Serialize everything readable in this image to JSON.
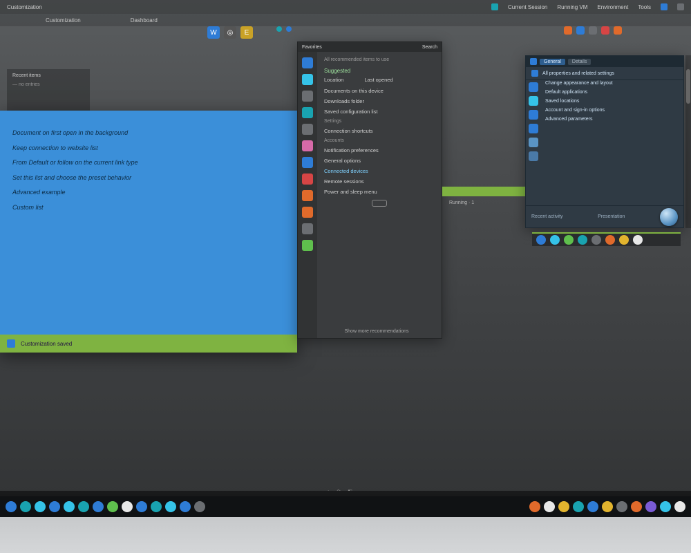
{
  "menubar": {
    "left": "Customization",
    "items": [
      "Current Session",
      "Running VM",
      "Environment",
      "Tools"
    ],
    "right_icons": [
      "globe-icon",
      "note-icon"
    ]
  },
  "tabs": {
    "a": "Customization",
    "b": "Dashboard"
  },
  "toolstrip_labels": [
    "W",
    "◎",
    "E"
  ],
  "panel_left": {
    "line1": "Recent items",
    "line2": "— no entries"
  },
  "doc": {
    "lines": [
      "Document on first open in the background",
      "Keep connection to website list",
      "From Default or follow on the current link type",
      "Set this list and choose the preset behavior",
      "Advanced example",
      "Custom list"
    ],
    "status": "Customization saved"
  },
  "start": {
    "title_left": "Favorites",
    "title_right": "Search",
    "subtitle": "All recommended items to use",
    "section_a": "Suggested",
    "header_l": "Location",
    "header_r": "Last opened",
    "items": [
      "Documents on this device",
      "Downloads folder",
      "Saved configuration list",
      "Settings",
      "Connection shortcuts",
      "Accounts",
      "Notification preferences",
      "General options",
      "Connected devices",
      "Remote sessions",
      "Power and sleep menu"
    ],
    "footer": "Show more recommendations"
  },
  "greenlabel": "Running · 1",
  "prop": {
    "tab_a": "General",
    "tab_b": "Details",
    "header": "All properties and related settings",
    "rows": [
      "Change appearance and layout",
      "Default applications",
      "Saved locations",
      "Account and sign-in options",
      "Advanced parameters"
    ],
    "foot_l": "Recent activity",
    "foot_r": "Presentation"
  },
  "minibar_colors": [
    "c-blue",
    "c-cyan",
    "c-green",
    "c-teal",
    "c-grey",
    "c-orn",
    "c-yel",
    "c-white"
  ],
  "taskbar_left": [
    "c-blue",
    "c-teal",
    "c-cyan",
    "c-blue",
    "c-cyan",
    "c-teal",
    "c-blue",
    "c-green",
    "c-white",
    "c-blue",
    "c-teal",
    "c-cyan",
    "c-blue",
    "c-grey"
  ],
  "taskbar_right": [
    "c-orn",
    "c-white",
    "c-yel",
    "c-teal",
    "c-blue",
    "c-yel",
    "c-grey",
    "c-orn",
    "c-pur",
    "c-cyan",
    "c-white"
  ],
  "smallbar": [
    "⌂",
    "⟳",
    "◧",
    "…"
  ]
}
